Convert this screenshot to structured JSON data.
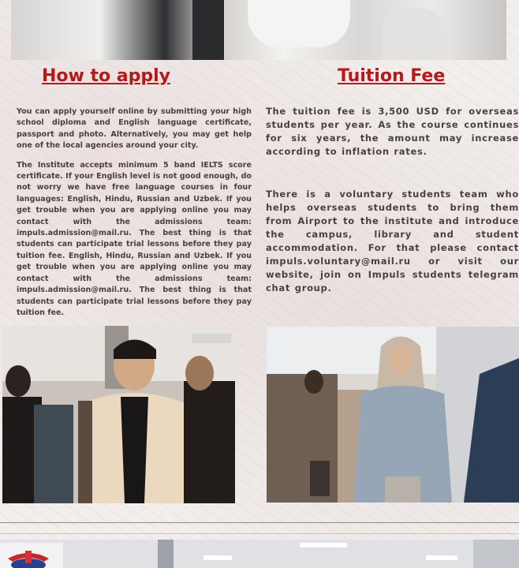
{
  "apply": {
    "heading": "How to apply ",
    "paragraphs": [
      "You can apply yourself online by submitting your high school diploma and English language certificate, passport and photo. Alternatively, you may get help one of the local agencies around your city.",
      "The Institute accepts minimum 5 band IELTS score certificate. If your English level is not good enough, do not worry we have free language courses in four languages: English, Hindu, Russian and Uzbek. If you get trouble when you are applying online you may contact with the admissions team: impuls.admission@mail.ru. The best thing is that students can participate trial lessons before they pay tuition fee. English, Hindu, Russian and Uzbek. If you get trouble when you are applying online you may contact with the admissions team: impuls.admission@mail.ru. The best thing is that students can participate trial lessons before they pay tuition fee."
    ]
  },
  "fee": {
    "heading": "Tuition Fee",
    "paragraphs": [
      "The tuition fee is 3,500 USD for overseas students per year. As the course continues for six years, the amount may increase according to inflation rates.",
      "There is a voluntary students team who helps overseas students to bring them from Airport to the institute and introduce the campus, library and student accommodation. For that please contact impuls.voluntary@mail.ru or visit our website, join on Impuls students telegram chat group."
    ]
  },
  "colors": {
    "heading": "#b81818",
    "body_text": "#4a4040"
  }
}
